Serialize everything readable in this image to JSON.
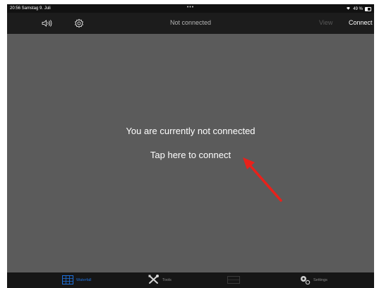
{
  "statusbar": {
    "time_date": "20:56  Samstag 9. Juli",
    "dots": "•••",
    "battery": "49 %"
  },
  "toolbar": {
    "title": "Not connected",
    "view_label": "View",
    "connect_label": "Connect",
    "icons": {
      "speaker": "speaker-icon",
      "settings": "gear-icon"
    }
  },
  "main": {
    "message": "You are currently not connected",
    "tap_label": "Tap here to connect",
    "annotation": "red-arrow-icon"
  },
  "tabbar": {
    "tabs": [
      {
        "label": "Waterfall",
        "icon": "waterfall-icon",
        "active": true
      },
      {
        "label": "Tools",
        "icon": "tools-icon",
        "active": false
      },
      {
        "label": "",
        "icon": "blank-icon",
        "active": false
      },
      {
        "label": "Settings",
        "icon": "gears-icon",
        "active": false
      }
    ]
  },
  "colors": {
    "accent": "#1e6fd9",
    "content_bg": "#5b5b5b",
    "toolbar_bg": "#1c1c1c",
    "arrow": "#e8211b"
  }
}
